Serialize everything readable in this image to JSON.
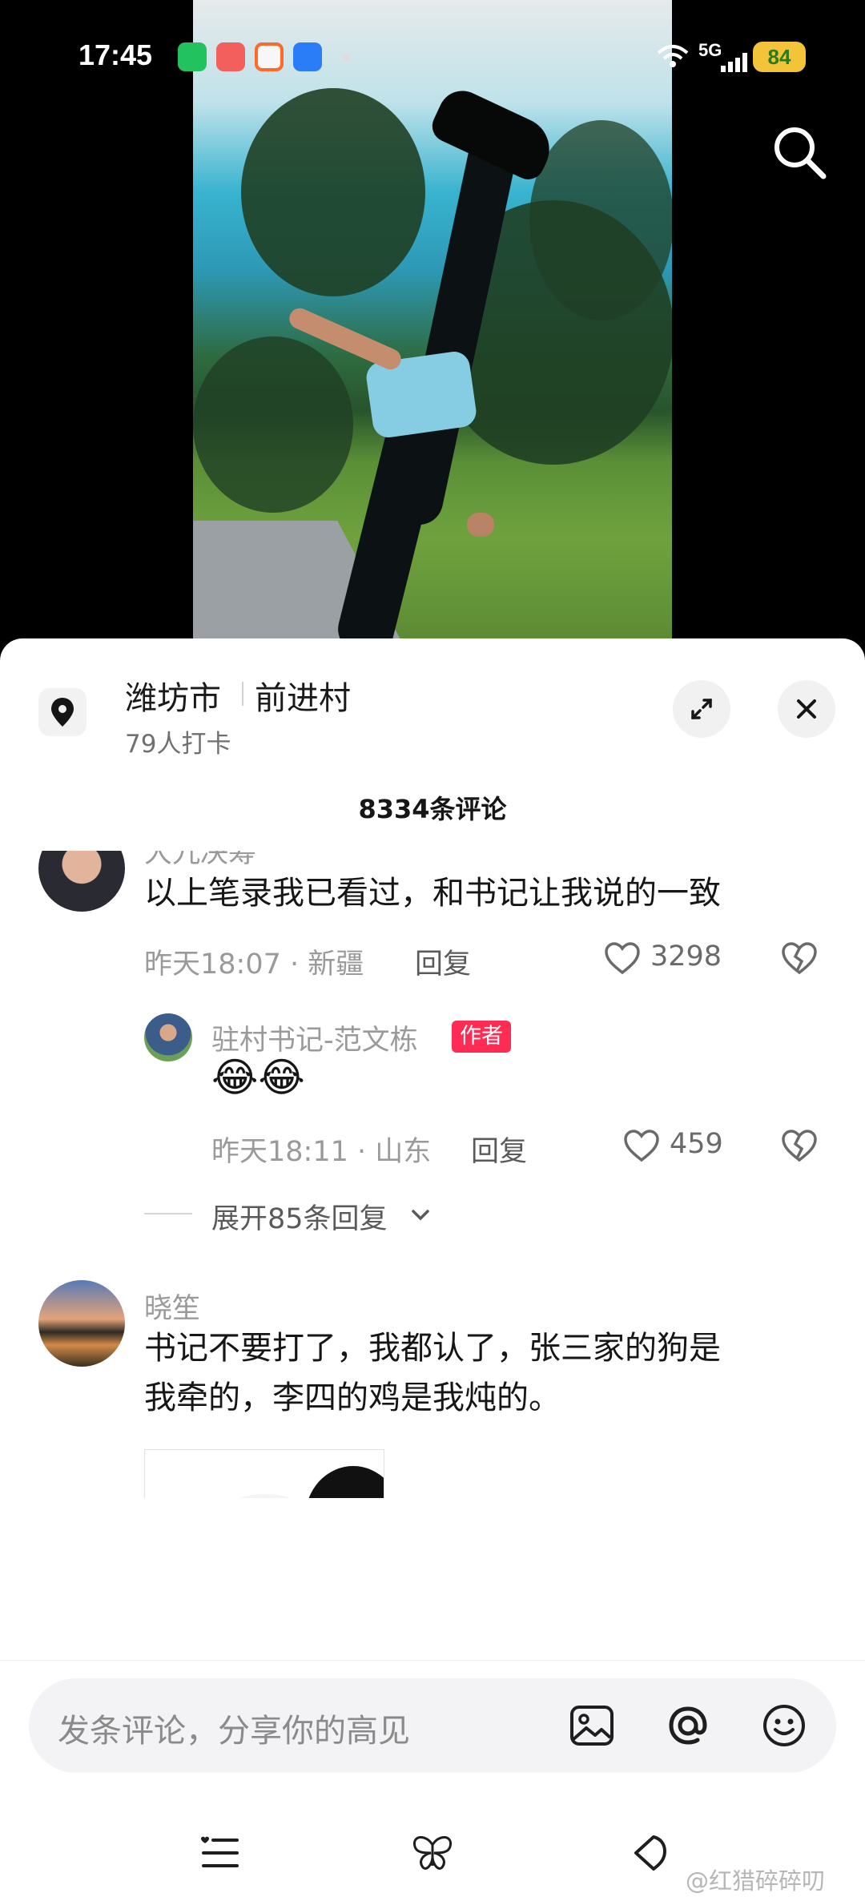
{
  "status_bar": {
    "time": "17:45",
    "network": "5G",
    "battery": "84"
  },
  "video": {
    "search_icon": "search-icon"
  },
  "location": {
    "city": "潍坊市",
    "village": "前进村",
    "checkins": "79人打卡",
    "pin_icon": "location-pin-icon"
  },
  "comments_header": {
    "count_label": "8334条评论"
  },
  "comments": [
    {
      "username": "大九决筹",
      "text": "以上笔录我已看过，和书记让我说的一致",
      "time": "昨天18:07 · 新疆",
      "reply_label": "回复",
      "likes": "3298",
      "reply": {
        "username": "驻村书记-范文栋",
        "badge": "作者",
        "text": "😂😂",
        "time": "昨天18:11 · 山东",
        "reply_label": "回复",
        "likes": "459"
      },
      "expand_label": "展开85条回复"
    },
    {
      "username": "晓笙",
      "text_line1": "书记不要打了，我都认了，张三家的狗是",
      "text_line2": "我牵的，李四的鸡是我炖的。",
      "sticker": "panda-meme-sticker"
    }
  ],
  "input": {
    "placeholder": "发条评论，分享你的高见"
  },
  "watermark": "@红猎碎碎叨",
  "colors": {
    "author_badge": "#fe2c55",
    "battery": "#f3c33a"
  }
}
